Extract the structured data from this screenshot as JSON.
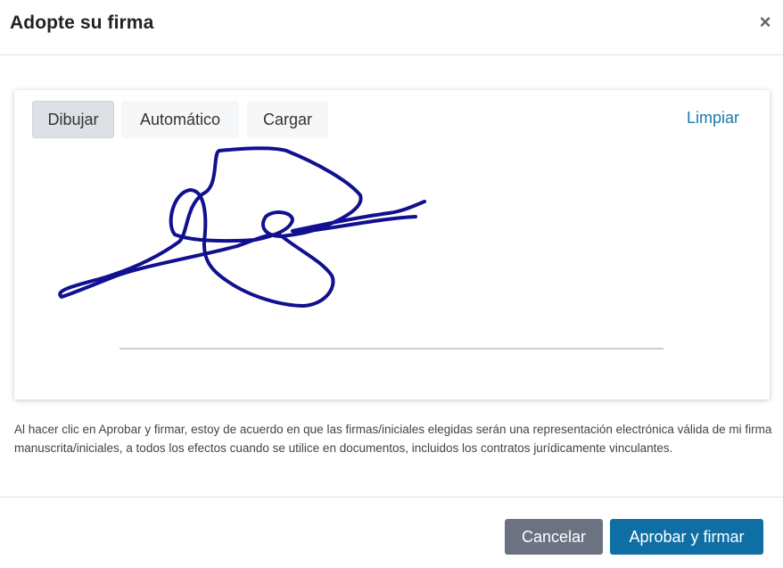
{
  "modal": {
    "title": "Adopte su firma",
    "close_symbol": "×"
  },
  "tabs": [
    {
      "label": "Dibujar",
      "active": true
    },
    {
      "label": "Automático",
      "active": false
    },
    {
      "label": "Cargar",
      "active": false
    }
  ],
  "clear_label": "Limpiar",
  "signature": {
    "ink_color": "#101090"
  },
  "disclaimer": "Al hacer clic en Aprobar y firmar, estoy de acuerdo en que las firmas/iniciales elegidas serán una representación electrónica válida de mi firma manuscrita/iniciales, a todos los efectos cuando se utilice en documentos, incluidos los contratos jurídicamente vinculantes.",
  "footer": {
    "cancel_label": "Cancelar",
    "approve_label": "Aprobar y firmar"
  },
  "colors": {
    "approve_button": "#0f6fa5",
    "cancel_button": "#6c7282",
    "link": "#1a7aaa"
  }
}
